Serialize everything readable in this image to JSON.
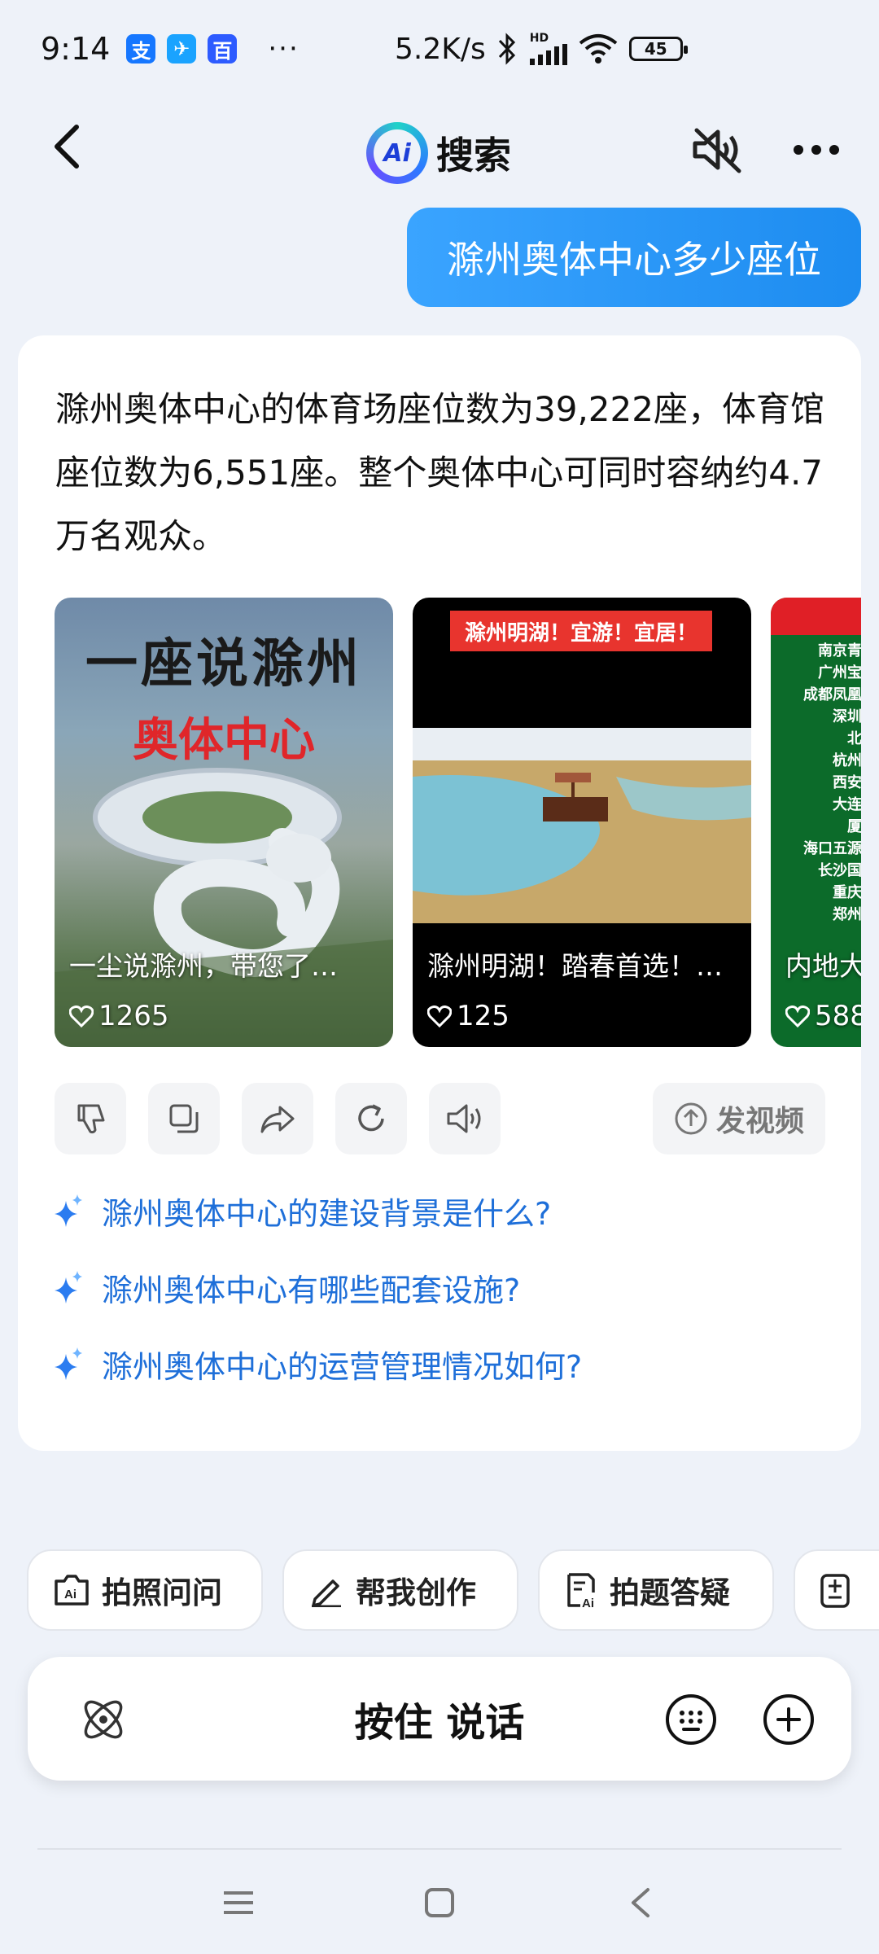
{
  "status_bar": {
    "time": "9:14",
    "apps": [
      "支",
      "✈",
      "百"
    ],
    "more": "···",
    "net_speed": "5.2K/s",
    "signal_label": "HD",
    "battery": "45"
  },
  "header": {
    "logo_text": "Ai",
    "title": "搜索"
  },
  "user_message": "滁州奥体中心多少座位",
  "answer": {
    "text": "滁州奥体中心的体育场座位数为39,222座，体育馆座位数为6,551座。整个奥体中心可同时容纳约4.7万名观众。"
  },
  "videos": [
    {
      "title": "一尘说滁州，带您了…",
      "likes": "1265",
      "overlay_line1": "一座说滁州",
      "overlay_line2": "奥体中心"
    },
    {
      "title": "滁州明湖！踏春首选！…",
      "likes": "125",
      "banner": "滁州明湖！宜游！宜居！"
    },
    {
      "title": "内地大…",
      "likes": "588",
      "list_lines": [
        "南京青",
        "广州宝",
        "成都凤凰",
        "深圳",
        "北",
        "杭州",
        "西安",
        "大连",
        "厦",
        "海口五源",
        "长沙国",
        "重庆",
        "郑州"
      ]
    }
  ],
  "actions": {
    "video_gen_label": "发视频"
  },
  "suggestions": [
    "滁州奥体中心的建设背景是什么?",
    "滁州奥体中心有哪些配套设施?",
    "滁州奥体中心的运营管理情况如何?"
  ],
  "tools": [
    {
      "label": "拍照问问",
      "icon": "camera-ai-icon"
    },
    {
      "label": "帮我创作",
      "icon": "pen-icon"
    },
    {
      "label": "拍题答疑",
      "icon": "doc-ai-icon"
    },
    {
      "label": "",
      "icon": "notes-icon"
    }
  ],
  "input": {
    "hold_to_talk": "按住 说话"
  },
  "colors": {
    "accent": "#1d8cf0",
    "link": "#1e6fd9",
    "background": "#eef2f9"
  }
}
